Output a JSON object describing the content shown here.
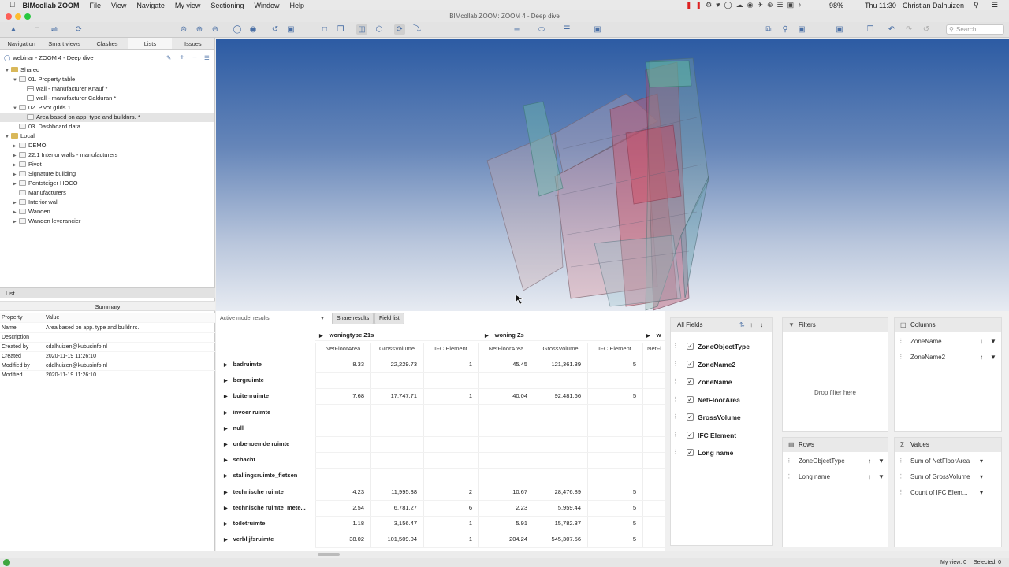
{
  "menubar": {
    "app_name": "BIMcollab ZOOM",
    "items": [
      "File",
      "View",
      "Navigate",
      "My view",
      "Sectioning",
      "Window",
      "Help"
    ],
    "battery": "98%",
    "clock": "Thu 11:30",
    "user": "Christian Dalhuizen"
  },
  "window": {
    "title": "BIMcollab ZOOM: ZOOM 4 - Deep dive"
  },
  "toolbar": {
    "search_placeholder": "Search"
  },
  "left_tabs": [
    "Navigation",
    "Smart views",
    "Clashes",
    "Lists",
    "Issues"
  ],
  "project": {
    "name": "webinar - ZOOM 4 - Deep dive"
  },
  "tree": [
    {
      "label": "Shared",
      "level": 0,
      "expanded": true,
      "icon": "folder-shared"
    },
    {
      "label": "01. Property table",
      "level": 1,
      "expanded": true,
      "icon": "layers"
    },
    {
      "label": "wall - manufacturer Knauf *",
      "level": 2,
      "icon": "grid"
    },
    {
      "label": "wall - manufacturer Calduran *",
      "level": 2,
      "icon": "grid"
    },
    {
      "label": "02. Pivot grids 1",
      "level": 1,
      "expanded": true,
      "icon": "layers"
    },
    {
      "label": "Area based on app. type and buildnrs. *",
      "level": 2,
      "icon": "pivot",
      "selected": true
    },
    {
      "label": "03. Dashboard data",
      "level": 1,
      "icon": "layers"
    },
    {
      "label": "Local",
      "level": 0,
      "expanded": true,
      "icon": "folder-local"
    },
    {
      "label": "DEMO",
      "level": 1,
      "collapsed": true,
      "icon": "layers"
    },
    {
      "label": "22.1 Interior walls - manufacturers",
      "level": 1,
      "collapsed": true,
      "icon": "layers"
    },
    {
      "label": "Pivot",
      "level": 1,
      "collapsed": true,
      "icon": "layers"
    },
    {
      "label": "Signature building",
      "level": 1,
      "collapsed": true,
      "icon": "layers"
    },
    {
      "label": "Pontsteiger HOCO",
      "level": 1,
      "collapsed": true,
      "icon": "layers"
    },
    {
      "label": "Manufacturers",
      "level": 1,
      "icon": "layers"
    },
    {
      "label": "Interior wall",
      "level": 1,
      "collapsed": true,
      "icon": "layers"
    },
    {
      "label": "Wanden",
      "level": 1,
      "collapsed": true,
      "icon": "layers"
    },
    {
      "label": "Wanden leverancier",
      "level": 1,
      "collapsed": true,
      "icon": "layers"
    }
  ],
  "list_panel": {
    "title": "List",
    "summary_header": "Summary",
    "col_property": "Property",
    "col_value": "Value",
    "rows": [
      [
        "Name",
        "Area based on app. type and buildnrs."
      ],
      [
        "Description",
        ""
      ],
      [
        "Created by",
        "cdalhuizen@kubusinfo.nl"
      ],
      [
        "Created",
        "2020-11-19 11:26:10"
      ],
      [
        "Modified by",
        "cdalhuizen@kubusinfo.nl"
      ],
      [
        "Modified",
        "2020-11-19 11:26:10"
      ]
    ]
  },
  "pivot": {
    "model_select": "Active model results",
    "share_button": "Share results",
    "fieldlist_button": "Field list",
    "groups": [
      "woningtype Z1s",
      "woning Zs",
      "w"
    ],
    "subcols": [
      "NetFloorArea",
      "GrossVolume",
      "IFC Element",
      "NetFloorArea",
      "GrossVolume",
      "IFC Element",
      "NetFl"
    ],
    "rows": [
      {
        "label": "badruimte",
        "v": [
          "8.33",
          "22,229.73",
          "1",
          "45.45",
          "121,361.39",
          "5"
        ]
      },
      {
        "label": "bergruimte",
        "v": [
          "",
          "",
          "",
          "",
          "",
          ""
        ]
      },
      {
        "label": "buitenruimte",
        "v": [
          "7.68",
          "17,747.71",
          "1",
          "40.04",
          "92,481.66",
          "5"
        ]
      },
      {
        "label": "invoer ruimte",
        "v": [
          "",
          "",
          "",
          "",
          "",
          ""
        ]
      },
      {
        "label": "null",
        "v": [
          "",
          "",
          "",
          "",
          "",
          ""
        ]
      },
      {
        "label": "onbenoemde ruimte",
        "v": [
          "",
          "",
          "",
          "",
          "",
          ""
        ]
      },
      {
        "label": "schacht",
        "v": [
          "",
          "",
          "",
          "",
          "",
          ""
        ]
      },
      {
        "label": "stallingsruimte_fietsen",
        "v": [
          "",
          "",
          "",
          "",
          "",
          ""
        ]
      },
      {
        "label": "technische ruimte",
        "v": [
          "4.23",
          "11,995.38",
          "2",
          "10.67",
          "28,476.89",
          "5"
        ]
      },
      {
        "label": "technische ruimte_mete...",
        "v": [
          "2.54",
          "6,781.27",
          "6",
          "2.23",
          "5,959.44",
          "5"
        ]
      },
      {
        "label": "toiletruimte",
        "v": [
          "1.18",
          "3,156.47",
          "1",
          "5.91",
          "15,782.37",
          "5"
        ]
      },
      {
        "label": "verblijfsruimte",
        "v": [
          "38.02",
          "101,509.04",
          "1",
          "204.24",
          "545,307.56",
          "5"
        ]
      }
    ]
  },
  "fields": {
    "all_fields_label": "All Fields",
    "items": [
      "ZoneObjectType",
      "ZoneName2",
      "ZoneName",
      "NetFloorArea",
      "GrossVolume",
      "IFC Element",
      "Long name"
    ],
    "filters_label": "Filters",
    "drop_filter": "Drop filter here",
    "columns_label": "Columns",
    "columns": [
      "ZoneName",
      "ZoneName2"
    ],
    "rows_label": "Rows",
    "rows": [
      "ZoneObjectType",
      "Long name"
    ],
    "values_label": "Values",
    "values": [
      "Sum of NetFloorArea",
      "Sum of GrossVolume",
      "Count of IFC Elem..."
    ]
  },
  "status": {
    "my_view": "My view: 0",
    "selected": "Selected: 0"
  },
  "colors": {
    "accent": "#4a6fa5",
    "viewport_top": "#2c5ba3",
    "viewport_bottom": "#e7ebf2"
  }
}
